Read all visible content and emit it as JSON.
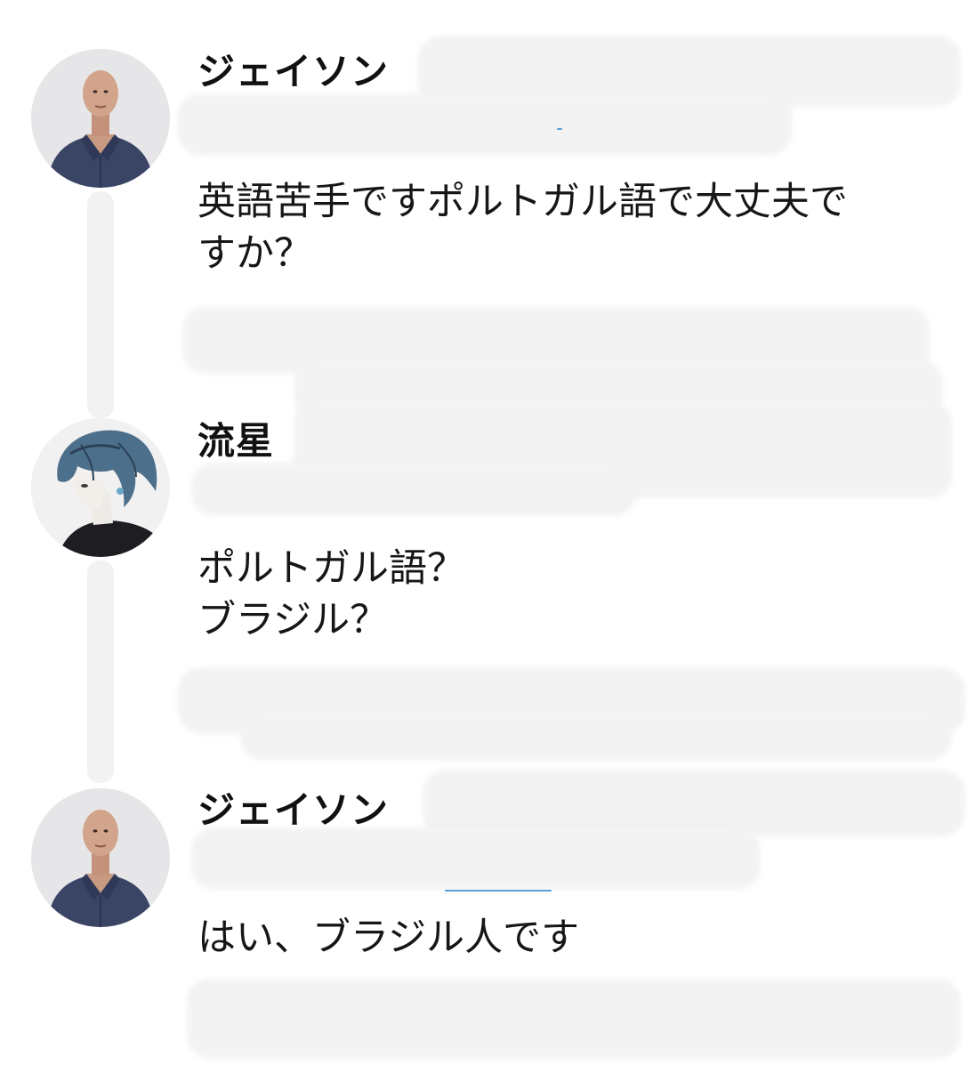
{
  "posts": [
    {
      "author": "ジェイソン",
      "avatar_icon": "bald-man-portrait-icon",
      "message_lines": [
        "英語苦手ですポルトガル語で大丈夫で",
        "すか？"
      ]
    },
    {
      "author": "流星",
      "avatar_icon": "anime-character-portrait-icon",
      "message_lines": [
        "ポルトガル語？",
        "ブラジル？"
      ]
    },
    {
      "author": "ジェイソン",
      "avatar_icon": "bald-man-portrait-icon",
      "message_lines": [
        "はい、ブラジル人です"
      ]
    }
  ],
  "colors": {
    "background": "#ffffff",
    "text": "#161616",
    "redaction": "#f3f3f3",
    "thread_line": "#f2f2f2"
  }
}
